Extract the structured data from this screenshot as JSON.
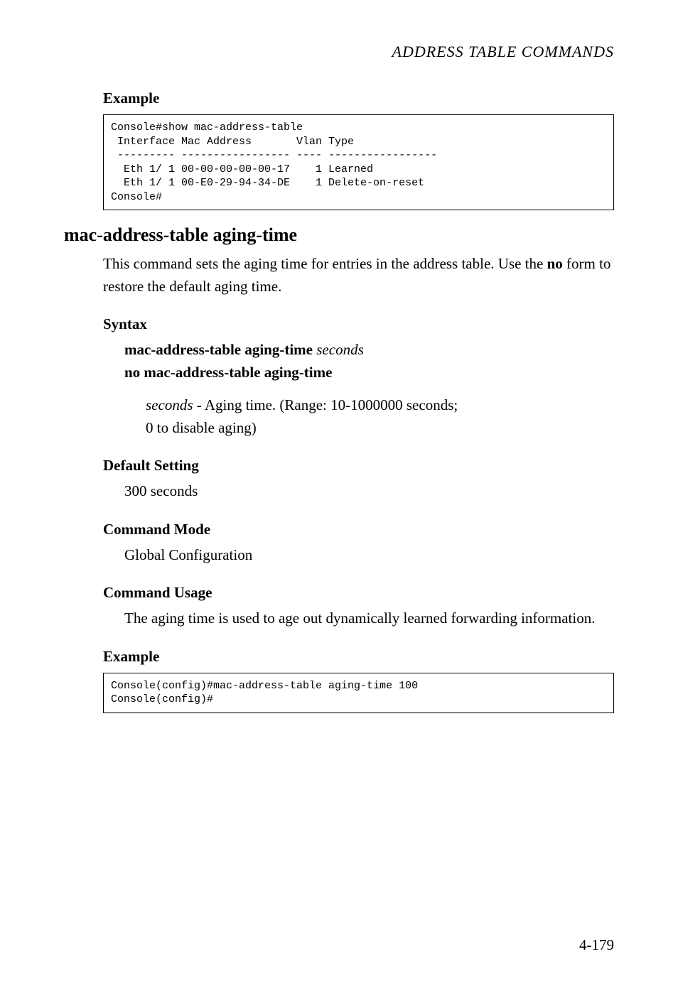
{
  "header": "ADDRESS TABLE COMMANDS",
  "example1": {
    "heading": "Example",
    "code": "Console#show mac-address-table\n Interface Mac Address       Vlan Type\n --------- ----------------- ---- -----------------\n  Eth 1/ 1 00-00-00-00-00-17    1 Learned\n  Eth 1/ 1 00-E0-29-94-34-DE    1 Delete-on-reset\nConsole#"
  },
  "command": {
    "title": "mac-address-table aging-time",
    "description_part1": "This command sets the aging time for entries in the address table. Use the ",
    "description_no": "no",
    "description_part2": " form to restore the default aging time."
  },
  "syntax": {
    "heading": "Syntax",
    "line1_bold": "mac-address-table aging-time",
    "line1_italic": "seconds",
    "line2_bold": "no mac-address-table aging-time",
    "param_italic": "seconds",
    "param_text": " - Aging time. (Range: 10-1000000 seconds;",
    "param_text2": "0 to disable aging)"
  },
  "default_setting": {
    "heading": "Default Setting",
    "text": "300 seconds"
  },
  "command_mode": {
    "heading": "Command Mode",
    "text": "Global Configuration"
  },
  "command_usage": {
    "heading": "Command Usage",
    "text": "The aging time is used to age out dynamically learned forwarding information."
  },
  "example2": {
    "heading": "Example",
    "code": "Console(config)#mac-address-table aging-time 100\nConsole(config)#"
  },
  "page_number": "4-179"
}
